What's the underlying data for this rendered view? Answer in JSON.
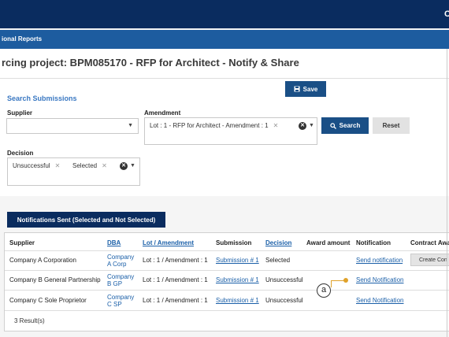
{
  "header": {
    "corner_glyph": "C"
  },
  "subnav": {
    "label": "ional Reports"
  },
  "page": {
    "title": "rcing project: BPM085170 - RFP for Architect - Notify & Share"
  },
  "toolbar": {
    "save_label": "Save",
    "save_icon": "floppy-disk-icon"
  },
  "search": {
    "legend": "Search Submissions",
    "supplier_label": "Supplier",
    "supplier_value": "",
    "amendment_label": "Amendment",
    "amendment_chip": "Lot : 1 - RFP for Architect - Amendment : 1",
    "decision_label": "Decision",
    "decision_chips": [
      "Unsuccessful",
      "Selected"
    ],
    "search_button": "Search",
    "reset_button": "Reset"
  },
  "tab_button": "Notifications Sent (Selected and Not Selected)",
  "table": {
    "headers": [
      "Supplier",
      "DBA",
      "Lot / Amendment",
      "Submission",
      "Decision",
      "Award amount",
      "Notification",
      "Contract Awa"
    ],
    "rows": [
      {
        "supplier": "Company A Corporation",
        "dba_line1": "Company",
        "dba_line2": "A Corp",
        "lot": "Lot : 1 / Amendment : 1",
        "submission": "Submission # 1",
        "decision": "Selected",
        "award": "",
        "notification": "Send notification",
        "contract": "Create Con"
      },
      {
        "supplier": "Company B General Partnership",
        "dba_line1": "Company",
        "dba_line2": "B GP",
        "lot": "Lot : 1 / Amendment : 1",
        "submission": "Submission # 1",
        "decision": "Unsuccessful",
        "award": "",
        "notification": "Send Notification",
        "contract": ""
      },
      {
        "supplier": "Company C Sole Proprietor",
        "dba_line1": "Company",
        "dba_line2": "C SP",
        "lot": "Lot : 1 / Amendment : 1",
        "submission": "Submission # 1",
        "decision": "Unsuccessful",
        "award": "",
        "notification": "Send Notification",
        "contract": ""
      }
    ],
    "result_count": "3 Result(s)"
  },
  "annotation": {
    "label": "a"
  },
  "colors": {
    "navy": "#0a2c5f",
    "blue": "#1d5c9f",
    "button": "#1a4f86",
    "link": "#1a5fa8",
    "annotation": "#e0a22a"
  }
}
